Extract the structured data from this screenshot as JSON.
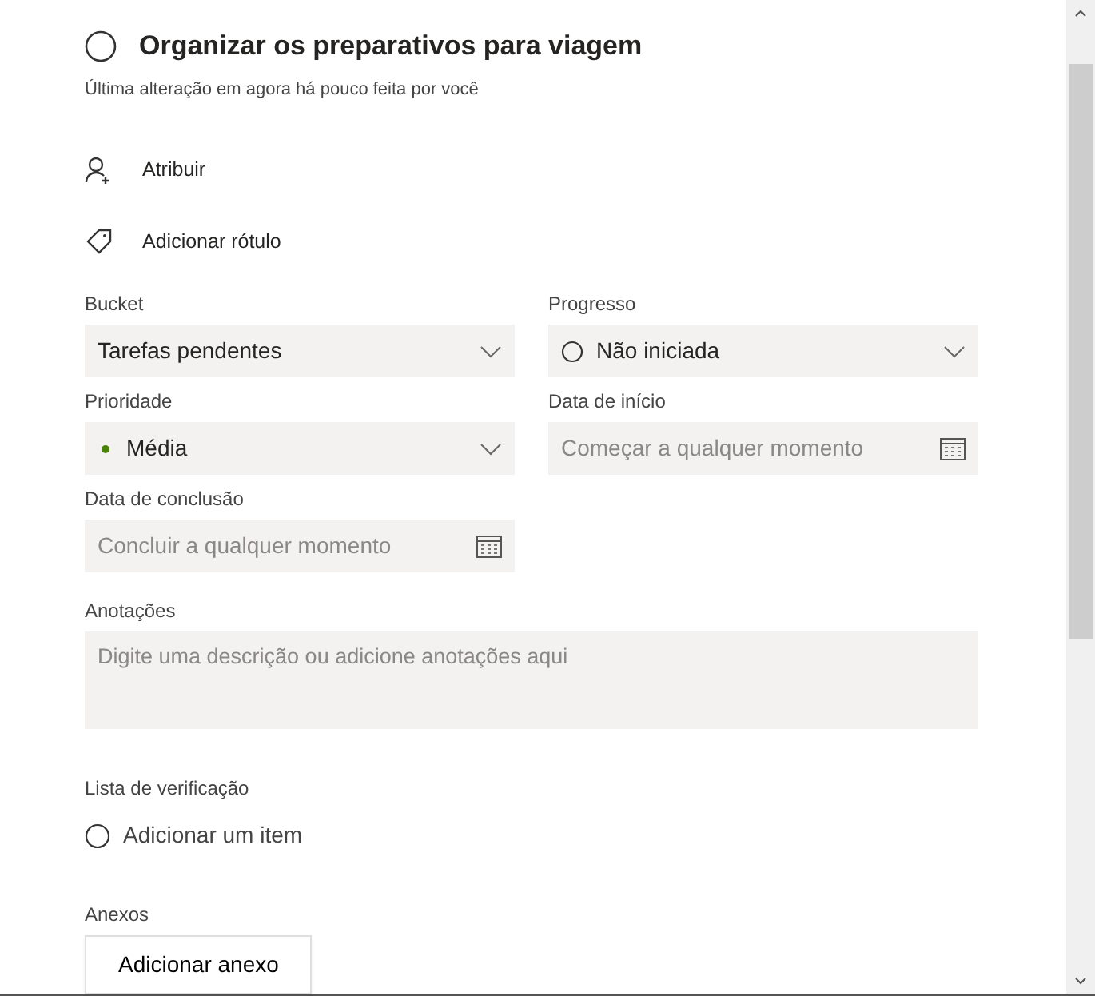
{
  "task": {
    "title": "Organizar os preparativos para viagem",
    "completed": false,
    "subtitle": "Última alteração em agora há pouco feita por você"
  },
  "actions": [
    {
      "kind": "assign",
      "label": "Atribuir"
    },
    {
      "kind": "tag",
      "label": "Adicionar rótulo"
    }
  ],
  "fields": [
    {
      "label": "Bucket",
      "kind": "select",
      "value": "Tarefas pendentes"
    },
    {
      "label": "Progresso",
      "kind": "status_select",
      "value": "Não iniciada"
    },
    {
      "label": "Prioridade",
      "kind": "priority_select",
      "value": "Média",
      "color": "#498205"
    },
    {
      "label": "Data de início",
      "kind": "date",
      "placeholder": "Começar a qualquer momento"
    },
    {
      "label": "Data de conclusão",
      "kind": "date",
      "placeholder": "Concluir a qualquer momento"
    }
  ],
  "notes": {
    "label": "Anotações",
    "placeholder": "Digite uma descrição ou adicione anotações aqui"
  },
  "checklist": {
    "label": "Lista de verificação",
    "placeholder": "Adicionar um item"
  },
  "attachments": {
    "label": "Anexos",
    "button": "Adicionar anexo"
  }
}
